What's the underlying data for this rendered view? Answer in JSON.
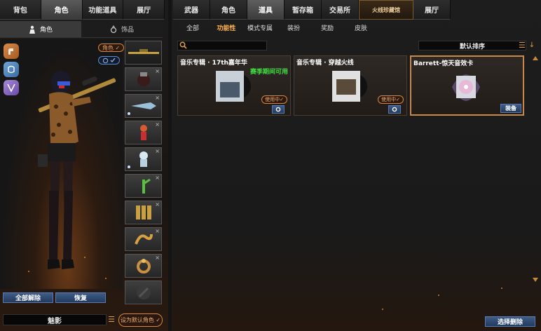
{
  "left": {
    "top_tabs": [
      {
        "label": "背包",
        "active": false
      },
      {
        "label": "角色",
        "active": true
      },
      {
        "label": "功能道具",
        "active": false
      },
      {
        "label": "展厅",
        "active": false
      }
    ],
    "sub_tabs": [
      {
        "label": "角色",
        "icon": "character-icon",
        "active": true
      },
      {
        "label": "饰品",
        "icon": "accessory-icon",
        "active": false
      }
    ],
    "role_pill": "角色 ✓",
    "buttons": {
      "remove_all": "全部解除",
      "restore": "恢复"
    },
    "name_field": "魅影",
    "set_default": "设为默认角色 ✓"
  },
  "right": {
    "top_tabs": [
      {
        "label": "武器",
        "active": false
      },
      {
        "label": "角色",
        "active": false
      },
      {
        "label": "道具",
        "active": true
      },
      {
        "label": "暂存箱",
        "active": false
      },
      {
        "label": "交易所",
        "active": false
      },
      {
        "label": "火线珍藏馆",
        "active": false,
        "special": true
      },
      {
        "label": "展厅",
        "active": false
      }
    ],
    "sub_tabs": [
      {
        "label": "全部",
        "active": false
      },
      {
        "label": "功能性",
        "active": true
      },
      {
        "label": "模式专属",
        "active": false
      },
      {
        "label": "装扮",
        "active": false
      },
      {
        "label": "奖励",
        "active": false
      },
      {
        "label": "皮肤",
        "active": false
      }
    ],
    "search_placeholder": "",
    "sort_label": "默认排序",
    "cards": [
      {
        "title": "音乐专辑 · 17th嘉年华",
        "status": "赛季期间可用",
        "badge": "使用中✓",
        "action": "gear"
      },
      {
        "title": "音乐专辑 · 穿越火线",
        "status": "",
        "badge": "使用中✓",
        "action": "gear"
      },
      {
        "title": "Barrett-惊天音效卡",
        "status": "",
        "badge": "",
        "action": "装备"
      }
    ],
    "select_remove": "选择删除"
  },
  "colors": {
    "accent_orange": "#d8883a",
    "button_blue": "#3e5c88",
    "status_green": "#40e040"
  }
}
